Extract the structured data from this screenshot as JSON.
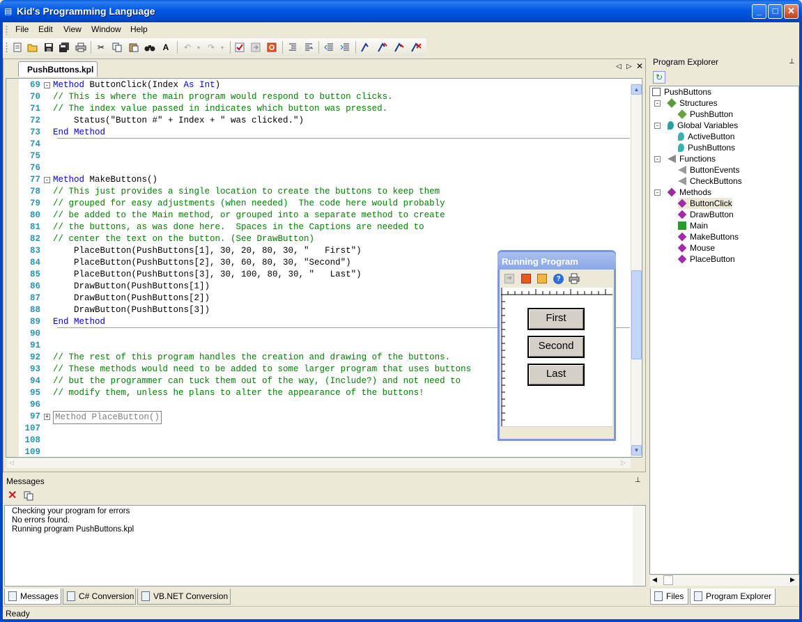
{
  "window": {
    "title": "Kid's Programming Language"
  },
  "menu": [
    "File",
    "Edit",
    "View",
    "Window",
    "Help"
  ],
  "toolbar": {
    "icons": [
      "new-icon",
      "open-icon",
      "save-icon",
      "save-all-icon",
      "print-icon",
      "cut-icon",
      "copy-icon",
      "paste-icon",
      "find-icon",
      "replace-icon",
      "undo-icon",
      "redo-icon",
      "check-icon",
      "run-icon",
      "stop-icon",
      "indent-icon",
      "comment-icon",
      "outdent-icon",
      "uncomment-icon",
      "breakpoint-icon",
      "step-icon",
      "step-over-icon",
      "clear-breakpoints-icon"
    ]
  },
  "editor": {
    "tab_label": "PushButtons.kpl",
    "lines": [
      {
        "num": "69",
        "text": "Method ButtonClick(Index As Int)",
        "kind": "method",
        "fold": "-"
      },
      {
        "num": "70",
        "text": "// This is where the main program would respond to button clicks.",
        "kind": "comment"
      },
      {
        "num": "71",
        "text": "// The index value passed in indicates which button was pressed.",
        "kind": "comment"
      },
      {
        "num": "72",
        "text": "    Status(\"Button #\" + Index + \" was clicked.\")",
        "kind": "code"
      },
      {
        "num": "73",
        "text": "End Method",
        "kind": "end"
      },
      {
        "num": "74",
        "text": "",
        "kind": "code"
      },
      {
        "num": "75",
        "text": "",
        "kind": "code"
      },
      {
        "num": "76",
        "text": "",
        "kind": "code"
      },
      {
        "num": "77",
        "text": "Method MakeButtons()",
        "kind": "method",
        "fold": "-"
      },
      {
        "num": "78",
        "text": "// This just provides a single location to create the buttons to keep them",
        "kind": "comment"
      },
      {
        "num": "79",
        "text": "// grouped for easy adjustments (when needed)  The code here would probably",
        "kind": "comment"
      },
      {
        "num": "80",
        "text": "// be added to the Main method, or grouped into a separate method to create",
        "kind": "comment"
      },
      {
        "num": "81",
        "text": "// the buttons, as was done here.  Spaces in the Captions are needed to",
        "kind": "comment"
      },
      {
        "num": "82",
        "text": "// center the text on the button. (See DrawButton)",
        "kind": "comment"
      },
      {
        "num": "83",
        "text": "    PlaceButton(PushButtons[1], 30, 20, 80, 30, \"   First\")",
        "kind": "code"
      },
      {
        "num": "84",
        "text": "    PlaceButton(PushButtons[2], 30, 60, 80, 30, \"Second\")",
        "kind": "code"
      },
      {
        "num": "85",
        "text": "    PlaceButton(PushButtons[3], 30, 100, 80, 30, \"   Last\")",
        "kind": "code"
      },
      {
        "num": "86",
        "text": "    DrawButton(PushButtons[1])",
        "kind": "code"
      },
      {
        "num": "87",
        "text": "    DrawButton(PushButtons[2])",
        "kind": "code"
      },
      {
        "num": "88",
        "text": "    DrawButton(PushButtons[3])",
        "kind": "code"
      },
      {
        "num": "89",
        "text": "End Method",
        "kind": "end"
      },
      {
        "num": "90",
        "text": "",
        "kind": "code"
      },
      {
        "num": "91",
        "text": "",
        "kind": "code"
      },
      {
        "num": "92",
        "text": "// The rest of this program handles the creation and drawing of the buttons.",
        "kind": "comment"
      },
      {
        "num": "93",
        "text": "// These methods would need to be added to some larger program that uses buttons",
        "kind": "comment"
      },
      {
        "num": "94",
        "text": "// but the programmer can tuck them out of the way, (Include?) and not need to",
        "kind": "comment"
      },
      {
        "num": "95",
        "text": "// modify them, unless he plans to alter the appearance of the buttons!",
        "kind": "comment"
      },
      {
        "num": "96",
        "text": "",
        "kind": "code"
      },
      {
        "num": "97",
        "text": "Method PlaceButton()",
        "kind": "collapsed",
        "fold": "+"
      },
      {
        "num": "107",
        "text": "",
        "kind": "code"
      },
      {
        "num": "108",
        "text": "",
        "kind": "code"
      },
      {
        "num": "109",
        "text": "",
        "kind": "code"
      }
    ]
  },
  "running_program": {
    "title": "Running Program",
    "buttons": [
      "First",
      "Second",
      "Last"
    ]
  },
  "explorer": {
    "title": "Program Explorer",
    "tree": [
      {
        "label": "PushButtons",
        "level": 0,
        "icon": "program-icon"
      },
      {
        "label": "Structures",
        "level": 1,
        "icon": "structures-icon",
        "exp": "-"
      },
      {
        "label": "PushButton",
        "level": 2,
        "icon": "structure-icon"
      },
      {
        "label": "Global Variables",
        "level": 1,
        "icon": "variables-icon",
        "exp": "-"
      },
      {
        "label": "ActiveButton",
        "level": 2,
        "icon": "variable-icon"
      },
      {
        "label": "PushButtons",
        "level": 2,
        "icon": "variable-icon"
      },
      {
        "label": "Functions",
        "level": 1,
        "icon": "functions-icon",
        "exp": "-"
      },
      {
        "label": "ButtonEvents",
        "level": 2,
        "icon": "function-icon"
      },
      {
        "label": "CheckButtons",
        "level": 2,
        "icon": "function-icon"
      },
      {
        "label": "Methods",
        "level": 1,
        "icon": "methods-icon",
        "exp": "-"
      },
      {
        "label": "ButtonClick",
        "level": 2,
        "icon": "method-icon",
        "selected": true
      },
      {
        "label": "DrawButton",
        "level": 2,
        "icon": "method-icon"
      },
      {
        "label": "Main",
        "level": 2,
        "icon": "main-method-icon"
      },
      {
        "label": "MakeButtons",
        "level": 2,
        "icon": "method-icon"
      },
      {
        "label": "Mouse",
        "level": 2,
        "icon": "method-icon"
      },
      {
        "label": "PlaceButton",
        "level": 2,
        "icon": "method-icon"
      }
    ],
    "tabs": [
      "Files",
      "Program Explorer"
    ]
  },
  "messages": {
    "title": "Messages",
    "lines": [
      "Checking your program for errors",
      "No errors found.",
      "Running program PushButtons.kpl"
    ],
    "tabs": [
      "Messages",
      "C# Conversion",
      "VB.NET Conversion"
    ]
  },
  "status": {
    "text": "Ready"
  },
  "colors": {
    "keyword": "#0000ff",
    "comment": "#008000",
    "line_number": "#2b91af",
    "titlebar": "#0058e6"
  }
}
